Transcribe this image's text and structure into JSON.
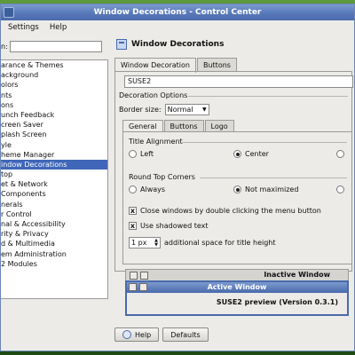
{
  "window": {
    "title": "Window Decorations - Control Center"
  },
  "menubar": {
    "items": [
      "Settings",
      "Help"
    ]
  },
  "search": {
    "label": "n:"
  },
  "modules": [
    "arance & Themes",
    "ackground",
    "olors",
    "nts",
    "ons",
    "unch Feedback",
    "creen Saver",
    "plash Screen",
    "yle",
    "heme Manager",
    "indow Decorations",
    "top",
    "et & Network",
    "Components",
    "nerals",
    "r Control",
    "nal & Accessibility",
    "rity & Privacy",
    "d & Multimedia",
    "em Administration",
    "2 Modules"
  ],
  "selected_module": "indow Decorations",
  "header": {
    "title": "Window Decorations"
  },
  "tabs": [
    "Window Decoration",
    "Buttons"
  ],
  "decoration_combo": "SUSE2",
  "decoration_options": {
    "title": "Decoration Options",
    "border_label": "Border size:",
    "border_value": "Normal",
    "subtabs": [
      "General",
      "Buttons",
      "Logo"
    ],
    "title_alignment": {
      "title": "Title Alignment",
      "options": [
        "Left",
        "Center",
        ""
      ],
      "selected": "Center"
    },
    "round_corners": {
      "title": "Round Top Corners",
      "options": [
        "Always",
        "Not maximized",
        ""
      ],
      "selected": "Not maximized"
    },
    "close_double_click": "Close windows by double clicking the menu button",
    "shadowed_text": "Use shadowed text",
    "title_space_value": "1 px",
    "title_space_label": "additional space for title height"
  },
  "preview": {
    "inactive_title": "Inactive Window",
    "active_title": "Active Window",
    "body_text": "SUSE2 preview (Version 0.3.1)"
  },
  "buttons": {
    "help": "Help",
    "defaults": "Defaults"
  }
}
